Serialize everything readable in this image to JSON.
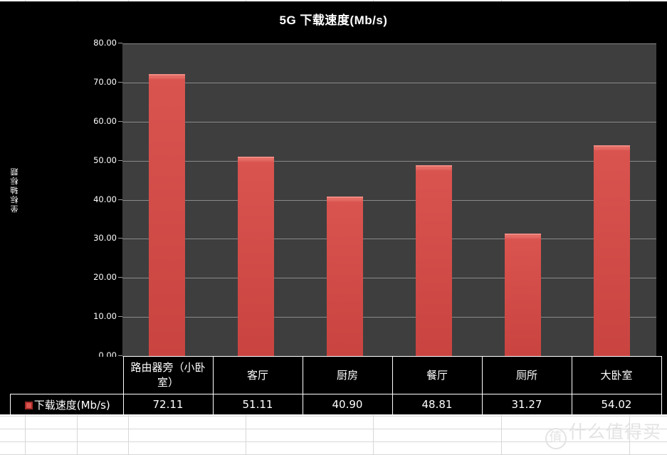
{
  "chart_data": {
    "type": "bar",
    "title": "5G 下载速度(Mb/s)",
    "xlabel": "",
    "ylabel": "坐标轴标题",
    "ylim": [
      0,
      80
    ],
    "ytick_labels": [
      "80.00",
      "70.00",
      "60.00",
      "50.00",
      "40.00",
      "30.00",
      "20.00",
      "10.00",
      "0.00"
    ],
    "ytick_values": [
      80,
      70,
      60,
      50,
      40,
      30,
      20,
      10,
      0
    ],
    "grid": true,
    "legend_position": "data-table",
    "categories": [
      "路由器旁（小卧室）",
      "客厅",
      "厨房",
      "餐厅",
      "厕所",
      "大卧室"
    ],
    "series": [
      {
        "name": "下载速度(Mb/s)",
        "color": "#d9534f",
        "values": [
          72.11,
          51.11,
          40.9,
          48.81,
          31.27,
          54.02
        ],
        "value_labels": [
          "72.11",
          "51.11",
          "40.90",
          "48.81",
          "31.27",
          "54.02"
        ]
      }
    ],
    "plot_background": "#3e3e3e",
    "chart_background": "#000000",
    "gridline_color": "#8a8a8a"
  },
  "chart": {
    "title": "5G 下载速度(Mb/s)",
    "y_axis_title": "坐标轴标题"
  },
  "data_table": {
    "legend_label": "下载速度(Mb/s)",
    "legend_marker": "red-square-marker",
    "categories": [
      "路由器旁（小卧室）",
      "客厅",
      "厨房",
      "餐厅",
      "厕所",
      "大卧室"
    ],
    "values": [
      "72.11",
      "51.11",
      "40.90",
      "48.81",
      "31.27",
      "54.02"
    ]
  },
  "watermark": {
    "mark": "值",
    "text": "什么值得买"
  }
}
